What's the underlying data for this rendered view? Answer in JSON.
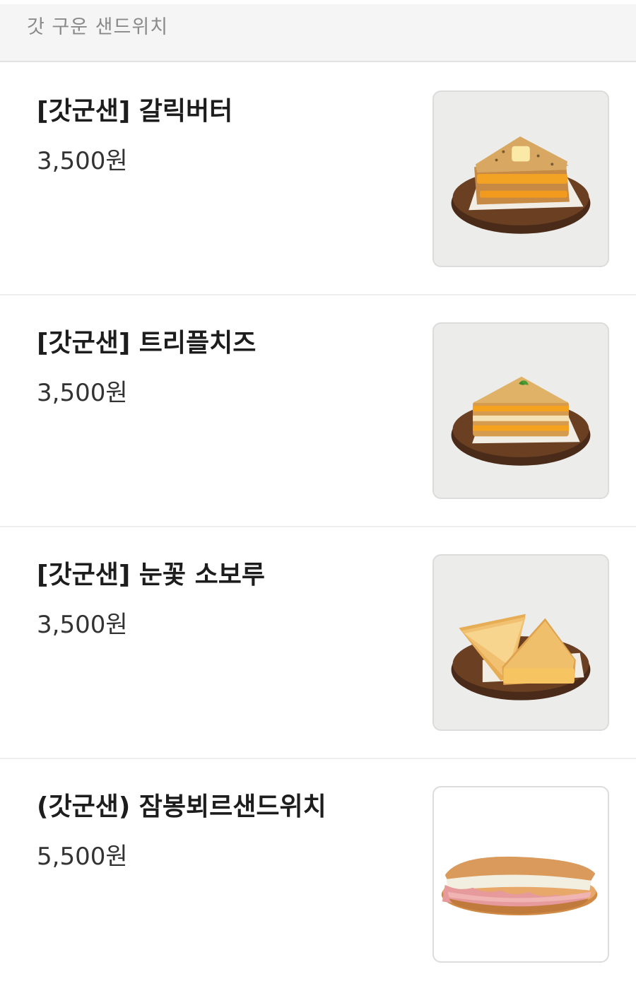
{
  "section": {
    "title": "갓 구운 샌드위치"
  },
  "items": [
    {
      "name": "[갓군샌] 갈릭버터",
      "price": "3,500원",
      "image_icon": "garlic-butter-sandwich-image"
    },
    {
      "name": "[갓군샌] 트리플치즈",
      "price": "3,500원",
      "image_icon": "triple-cheese-sandwich-image"
    },
    {
      "name": "[갓군샌] 눈꽃 소보루",
      "price": "3,500원",
      "image_icon": "snowflake-soboro-sandwich-image"
    },
    {
      "name": "(갓군샌) 잠봉뵈르샌드위치",
      "price": "5,500원",
      "image_icon": "jambon-beurre-sandwich-image"
    }
  ],
  "colors": {
    "cheese": "#f0a020",
    "bread": "#d9a75a",
    "board": "#5a3520"
  }
}
